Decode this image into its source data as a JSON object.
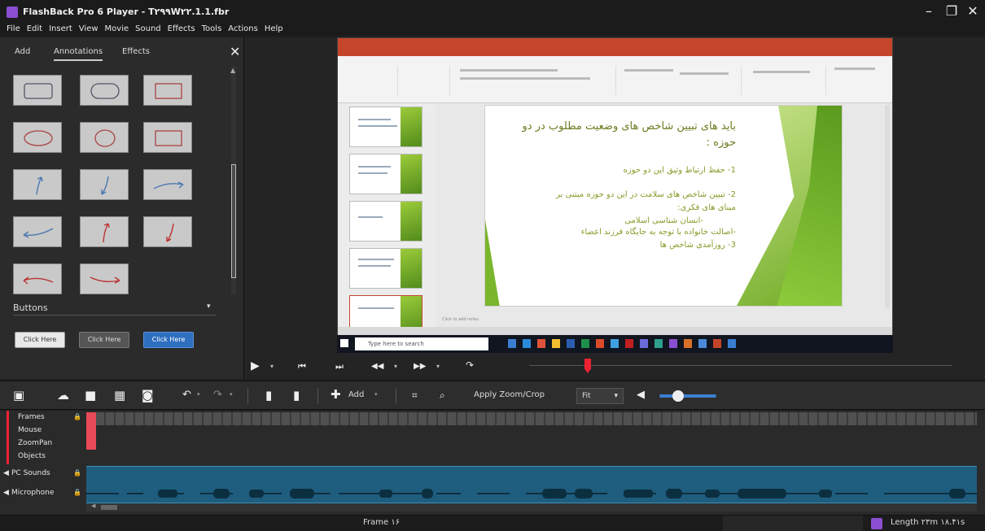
{
  "window": {
    "title": "FlashBack Pro 6 Player - T۲۹۹W۲۲.1.1.fbr",
    "minimize": "–",
    "maximize": "❐",
    "close": "✕"
  },
  "menu": [
    "File",
    "Edit",
    "Insert",
    "View",
    "Movie",
    "Sound",
    "Effects",
    "Tools",
    "Actions",
    "Help"
  ],
  "left_panel": {
    "tabs": [
      "Add",
      "Annotations",
      "Effects"
    ],
    "active_tab": "Annotations",
    "close": "✕",
    "shapes": [
      "rectangle",
      "rounded-rectangle",
      "rectangle-red",
      "ellipse-red",
      "circle",
      "rectangle-red-2",
      "arrow-up-right",
      "arrow-down-curve",
      "arrow-right-curve",
      "arrow-left-curve",
      "arrow-up-red",
      "arrow-down-red",
      "arrow-left-red",
      "arrow-right-red"
    ],
    "buttons_section": "Buttons",
    "buttons_dropdown": "▾",
    "buttons": [
      "Click Here",
      "Click Here",
      "Click Here"
    ]
  },
  "slide": {
    "title_line1": "باید های تبیین شاخص های وضعیت مطلوب در دو",
    "title_line2": "حوزه :",
    "item1": "1- حفظ ارتباط وثیق این دو حوزه",
    "item2a": "2- تبیین شاخص های سلامت در این دو حوزه مبتنی بر",
    "item2b": "مبنای های فکری:",
    "item2c": "-انسان شناسی اسلامی",
    "item2d": "-اصالت خانواده با توجه به جایگاه فرزند اعضاء",
    "item3": "3- روزآمدی شاخص ها"
  },
  "ppt": {
    "notes": "Click to add notes",
    "search": "Type here to search"
  },
  "playbar": {
    "play": "▶",
    "prev": "⏮",
    "next": "⏭",
    "rewind": "◀◀",
    "forward": "▶▶",
    "loop": "↷",
    "dropdown": "▾"
  },
  "toolbar": {
    "add_label": "Add",
    "apply_zoom": "Apply Zoom/Crop",
    "fit": "Fit"
  },
  "timeline": {
    "tracks": [
      "Frames",
      "Mouse",
      "ZoomPan",
      "Objects"
    ],
    "audio_tracks": [
      "PC Sounds",
      "Microphone"
    ]
  },
  "status": {
    "frame": "Frame ۱۶",
    "length": "Length ۲۳m ۱۸.۴۱s"
  },
  "colors": {
    "accent": "#8a4fd0",
    "playhead": "#e23344",
    "audio": "#1f5d7e",
    "ppt_orange": "#c4452a",
    "slide_green": "#7bb52e"
  }
}
